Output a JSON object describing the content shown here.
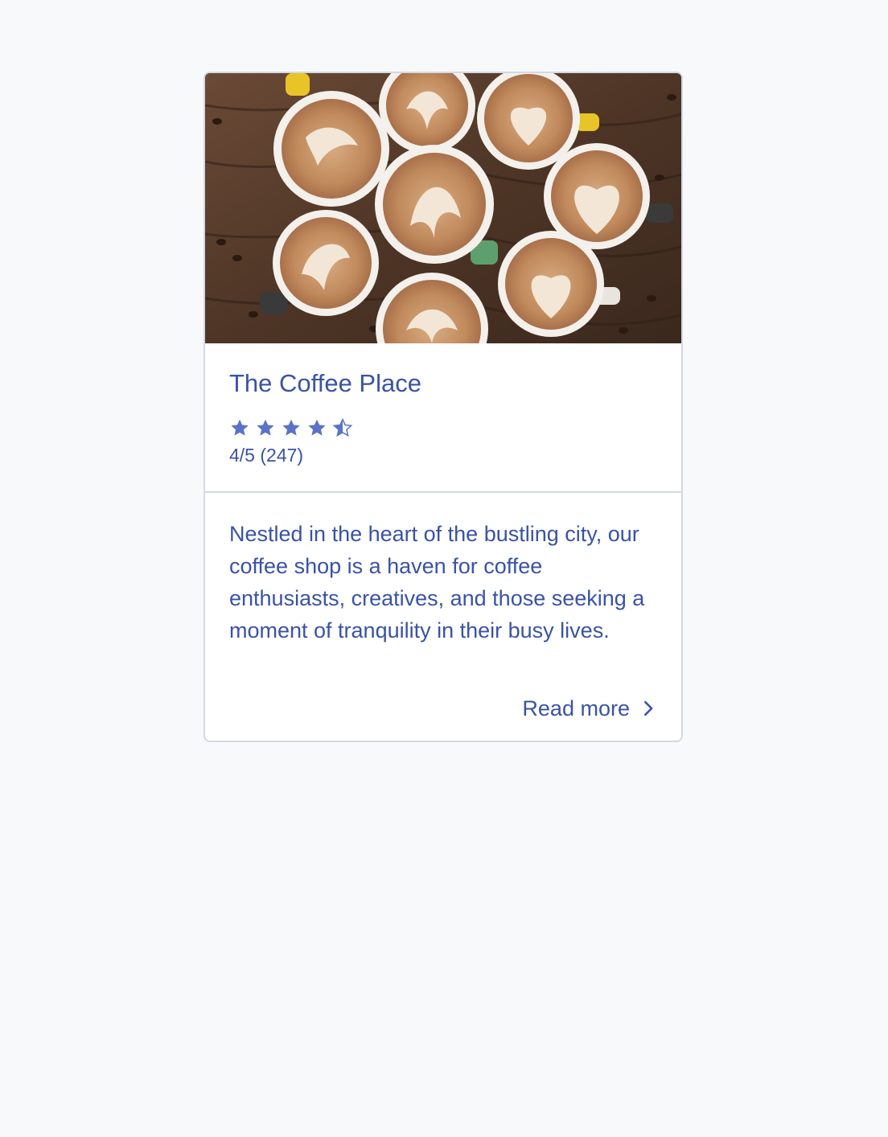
{
  "card": {
    "image": {
      "subject": "latte-art-coffee-cups-photo"
    },
    "title": "The Coffee Place",
    "rating": {
      "value": 4.5,
      "max": 5,
      "text": "4/5 (247)"
    },
    "description": "Nestled in the heart of the bustling city, our coffee shop is a haven for coffee enthusiasts, creatives, and those seeking a moment of tranquility in their busy lives.",
    "read_more": {
      "label": "Read more",
      "icon": "chevron-right-icon"
    }
  },
  "colors": {
    "page_background": "#f8f9fb",
    "card_background": "#ffffff",
    "card_border": "#d3d9e3",
    "text": "#3953a4",
    "star": "#5a72c8"
  }
}
